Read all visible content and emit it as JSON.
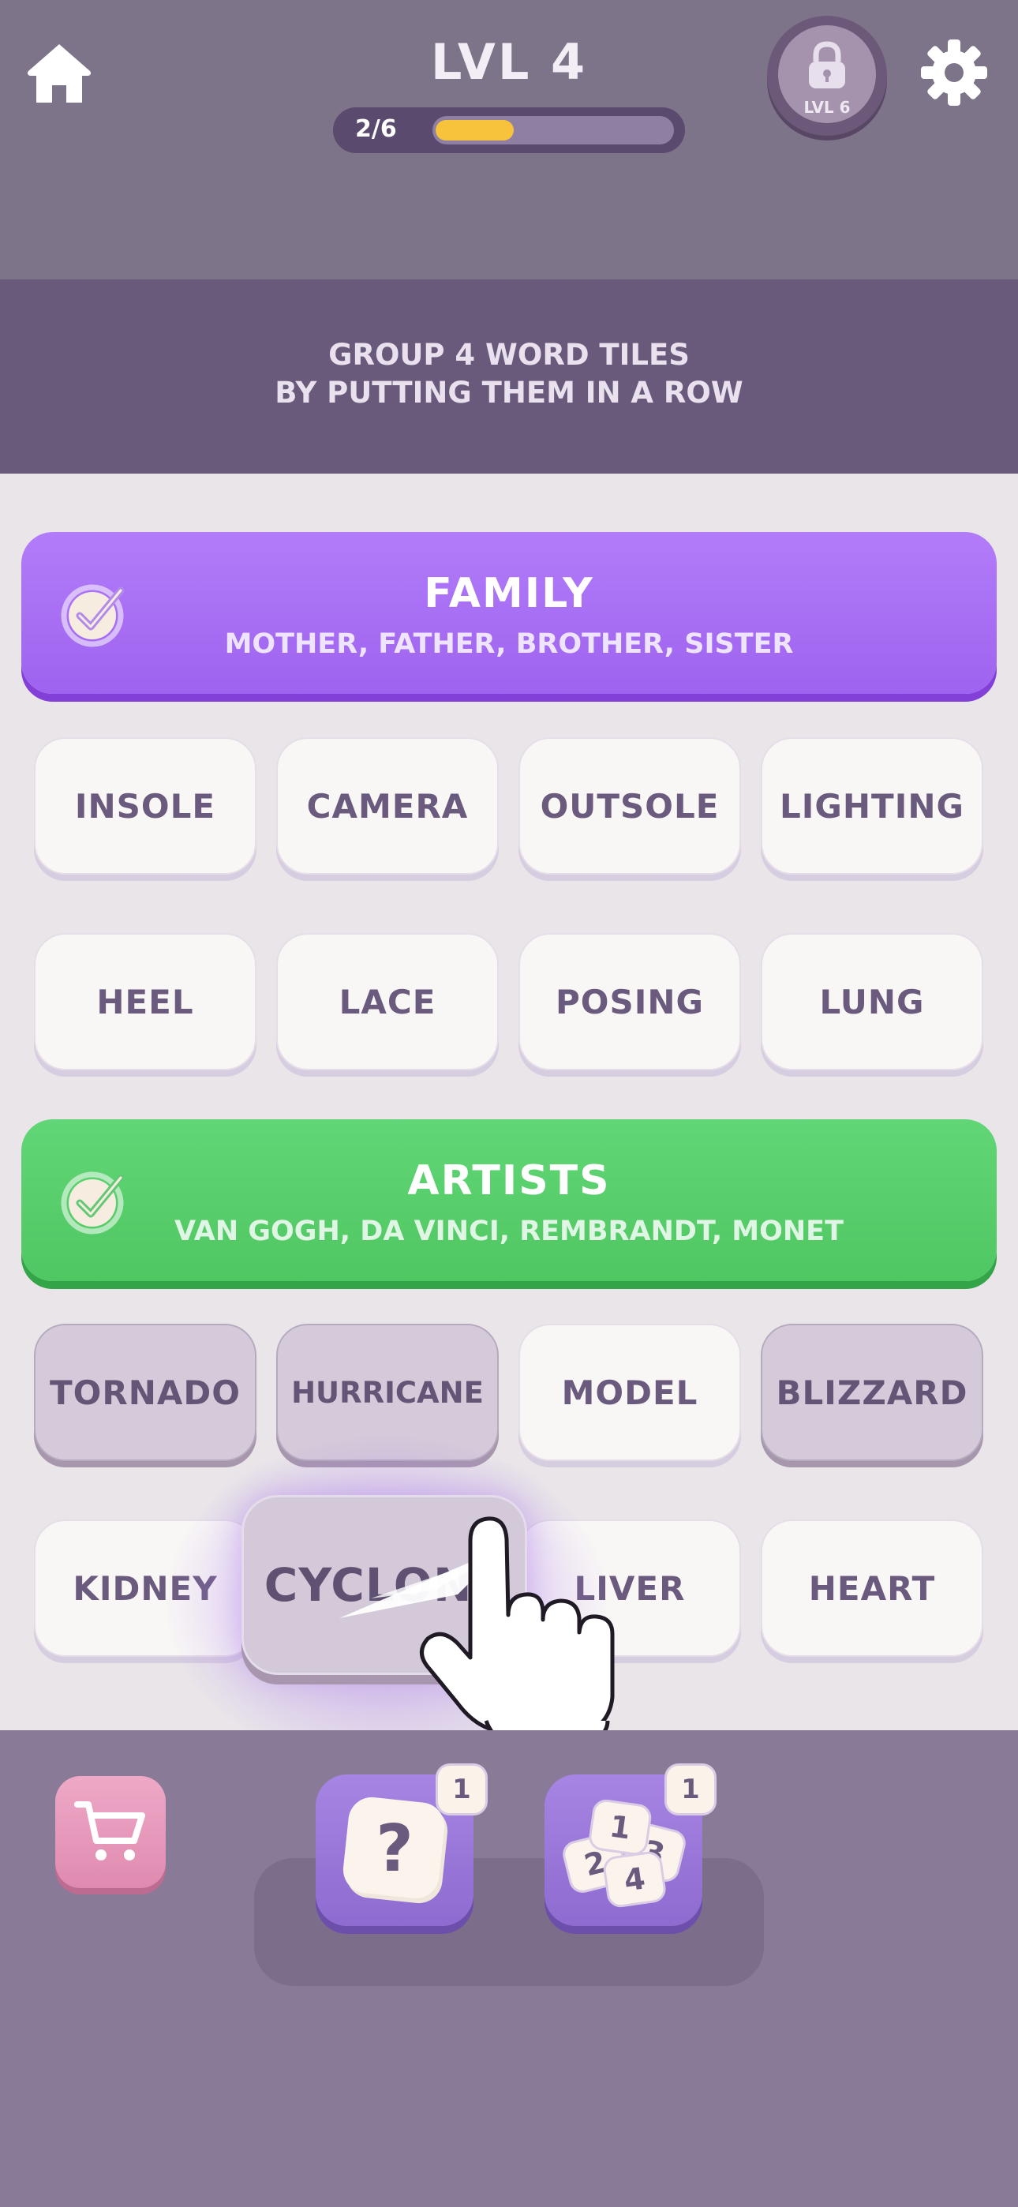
{
  "header": {
    "level_title": "LVL 4",
    "progress_text": "2/6",
    "progress_fraction": 0.333,
    "locked_level_label": "LVL 6",
    "icons": [
      "home-icon",
      "lock-icon",
      "gear-icon"
    ]
  },
  "instruction": {
    "line1": "GROUP 4 WORD TILES",
    "line2": "BY PUTTING THEM IN A ROW"
  },
  "solved_groups": [
    {
      "name": "FAMILY",
      "words": "MOTHER, FATHER, BROTHER, SISTER",
      "color": "#a96ff5"
    },
    {
      "name": "ARTISTS",
      "words": "VAN GOGH, DA VINCI, REMBRANDT, MONET",
      "color": "#57cf6b"
    }
  ],
  "tiles": {
    "row1": [
      "INSOLE",
      "CAMERA",
      "OUTSOLE",
      "LIGHTING"
    ],
    "row2": [
      "HEEL",
      "LACE",
      "POSING",
      "LUNG"
    ],
    "row3": [
      "TORNADO",
      "HURRICANE",
      "MODEL",
      "BLIZZARD"
    ],
    "row4": [
      "KIDNEY",
      "LIVER",
      "HEART"
    ],
    "dragging": "CYCLONE",
    "selected": [
      "TORNADO",
      "HURRICANE",
      "BLIZZARD"
    ]
  },
  "powerups": {
    "hint_count": "1",
    "shuffle_count": "1",
    "hint_icon": "question-icon",
    "shuffle_icon": "numbered-tiles-icon",
    "shuffle_digits": [
      "1",
      "2",
      "3",
      "4"
    ],
    "cart_icon": "cart-icon"
  },
  "colors": {
    "topbar": "#7e7489",
    "instruction_band": "#695a7b",
    "board": "#e9e5e9",
    "bottombar": "#897b97",
    "progress_fill": "#f6c33b",
    "tile_text": "#6a5a7e"
  }
}
